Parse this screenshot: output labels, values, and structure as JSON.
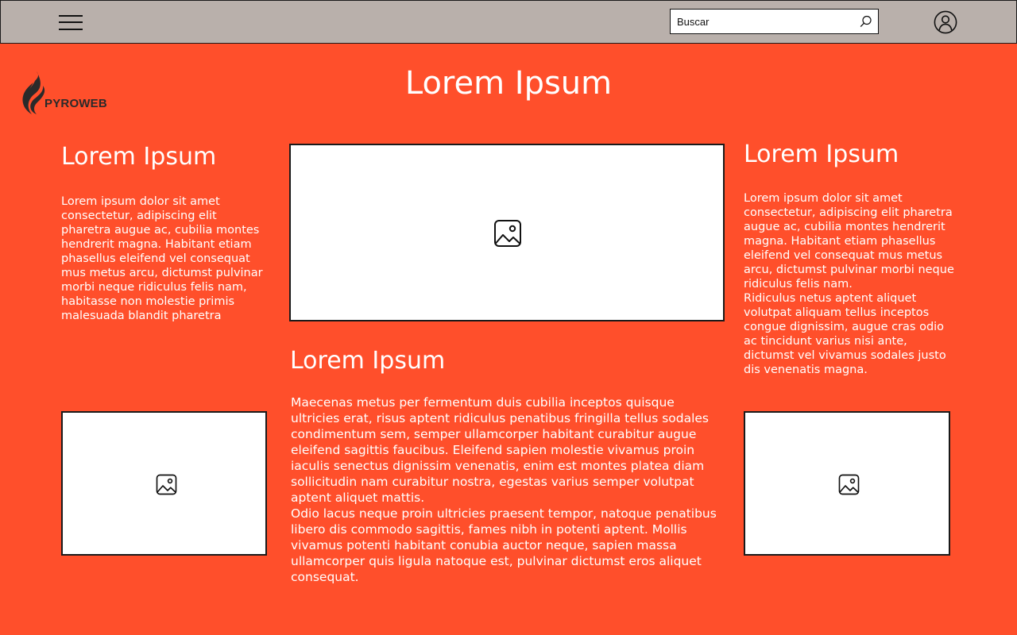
{
  "header": {
    "menu_icon": "hamburger-menu-icon",
    "search_placeholder": "Buscar",
    "search_icon": "search-icon",
    "user_icon": "user-account-icon"
  },
  "logo": {
    "text": "PYROWEB",
    "icon": "flame-icon",
    "colors": {
      "dark": "#2a2a2a"
    }
  },
  "page": {
    "title": "Lorem Ipsum",
    "background": "#ff4f2b",
    "topbar_background": "#b9b0ab"
  },
  "left": {
    "heading": "Lorem Ipsum",
    "text": "Lorem ipsum dolor sit amet consectetur, adipiscing elit pharetra augue ac, cubilia montes hendrerit magna. Habitant etiam phasellus eleifend vel consequat mus metus arcu, dictumst pulvinar morbi neque ridiculus felis nam, habitasse non molestie primis malesuada blandit pharetra",
    "image_icon": "image-placeholder-icon"
  },
  "center": {
    "image_icon": "image-placeholder-icon",
    "heading": "Lorem Ipsum",
    "text": "Maecenas metus per fermentum duis cubilia inceptos quisque ultricies erat, risus aptent ridiculus penatibus fringilla tellus sodales condimentum sem, semper ullamcorper habitant curabitur augue eleifend sagittis faucibus. Eleifend sapien molestie vivamus proin iaculis senectus dignissim venenatis, enim est montes platea diam sollicitudin nam curabitur nostra, egestas varius semper volutpat aptent aliquet mattis.\nOdio lacus neque proin ultricies praesent tempor, natoque penatibus libero dis commodo sagittis, fames nibh in potenti aptent. Mollis vivamus potenti habitant conubia auctor neque, sapien massa ullamcorper quis ligula natoque est, pulvinar dictumst eros aliquet consequat."
  },
  "right": {
    "heading": "Lorem Ipsum",
    "text": "Lorem ipsum dolor sit amet consectetur, adipiscing elit pharetra augue ac, cubilia montes hendrerit magna. Habitant etiam phasellus eleifend vel consequat mus metus arcu, dictumst pulvinar morbi neque ridiculus felis nam.\nRidiculus netus aptent aliquet volutpat aliquam tellus inceptos congue dignissim, augue cras odio ac tincidunt varius nisi ante, dictumst vel vivamus sodales justo dis venenatis magna.",
    "image_icon": "image-placeholder-icon"
  }
}
